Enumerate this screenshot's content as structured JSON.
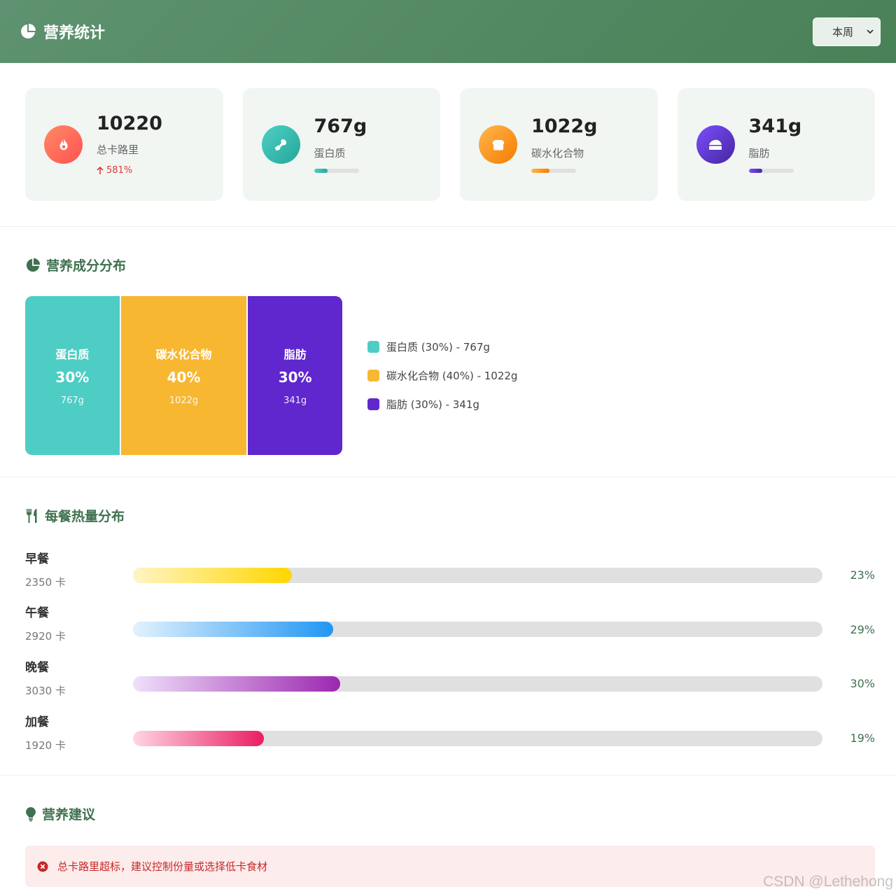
{
  "header": {
    "title": "营养统计",
    "period_label": "本周"
  },
  "stats": [
    {
      "value": "10220",
      "label": "总卡路里",
      "trend": "581%",
      "icon": "fire-icon",
      "color_from": "#ff8a65",
      "color_to": "#ff5252"
    },
    {
      "value": "767g",
      "label": "蛋白质",
      "progress": 0.3,
      "icon": "drumstick-icon",
      "color_from": "#4dd0c4",
      "color_to": "#26a69a"
    },
    {
      "value": "1022g",
      "label": "碳水化合物",
      "progress": 0.4,
      "icon": "bread-icon",
      "color_from": "#ffb74d",
      "color_to": "#f57c00"
    },
    {
      "value": "341g",
      "label": "脂肪",
      "progress": 0.3,
      "icon": "cheese-icon",
      "color_from": "#7c4dff",
      "color_to": "#4527a0"
    }
  ],
  "distribution": {
    "title": "营养成分分布",
    "segments": [
      {
        "name": "蛋白质",
        "pct": "30%",
        "value": "767g",
        "share": 30,
        "color": "#4ecdc4",
        "legend": "蛋白质 (30%) - 767g"
      },
      {
        "name": "碳水化合物",
        "pct": "40%",
        "value": "1022g",
        "share": 40,
        "color": "#f7b731",
        "legend": "碳水化合物 (40%) - 1022g"
      },
      {
        "name": "脂肪",
        "pct": "30%",
        "value": "341g",
        "share": 30,
        "color": "#5f27cd",
        "legend": "脂肪 (30%) - 341g"
      }
    ]
  },
  "meals": {
    "title": "每餐热量分布",
    "items": [
      {
        "name": "早餐",
        "kcal": "2350 卡",
        "pct": "23%",
        "fraction": 0.23,
        "color_from": "#fff5c4",
        "color_to": "#ffd600"
      },
      {
        "name": "午餐",
        "kcal": "2920 卡",
        "pct": "29%",
        "fraction": 0.29,
        "color_from": "#e3f2fd",
        "color_to": "#2196f3"
      },
      {
        "name": "晚餐",
        "kcal": "3030 卡",
        "pct": "30%",
        "fraction": 0.3,
        "color_from": "#f0e0fa",
        "color_to": "#9c27b0"
      },
      {
        "name": "加餐",
        "kcal": "1920 卡",
        "pct": "19%",
        "fraction": 0.19,
        "color_from": "#ffd6e2",
        "color_to": "#e91e63"
      }
    ]
  },
  "advice": {
    "title": "营养建议",
    "items": [
      {
        "text": "总卡路里超标，建议控制份量或选择低卡食材",
        "type": "error"
      }
    ]
  },
  "watermark": "CSDN @Lethehong"
}
